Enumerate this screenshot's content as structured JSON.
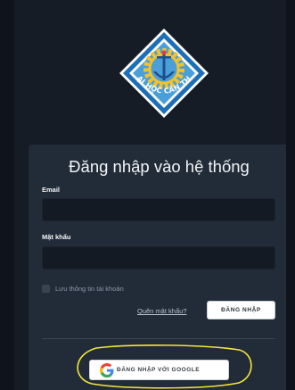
{
  "logo": {
    "text": "ĐẠI HỌC CẦN THƠ",
    "colors": {
      "diamond_border": "#1d6fb8",
      "diamond_fill": "#4a9fd8",
      "gear": "#f2c12e",
      "anchor": "#1c4f8c"
    }
  },
  "login": {
    "title": "Đăng nhập vào hệ thống",
    "email_label": "Email",
    "email_value": "",
    "password_label": "Mật khẩu",
    "password_value": "",
    "remember_label": "Lưu thông tin tài khoản",
    "forgot_label": "Quên mật khẩu?",
    "login_button": "ĐĂNG NHẬP",
    "google_button": "ĐĂNG NHẬP VỚI GOOGLE"
  },
  "colors": {
    "background": "#161c26",
    "card": "#222b38",
    "input": "#141a23",
    "highlight": "#f2e83a"
  }
}
